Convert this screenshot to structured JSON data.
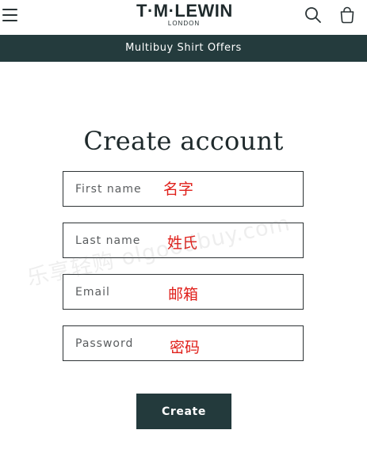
{
  "header": {
    "menu_icon": "hamburger-menu-icon",
    "logo_main": "T·M·LEWIN",
    "logo_sub": "LONDON",
    "search_icon": "search-icon",
    "cart_icon": "shopping-bag-icon"
  },
  "announcement": {
    "text": "Multibuy Shirt Offers"
  },
  "main": {
    "title": "Create account",
    "fields": [
      {
        "placeholder": "First name",
        "annotation": "名字"
      },
      {
        "placeholder": "Last name",
        "annotation": "姓氏"
      },
      {
        "placeholder": "Email",
        "annotation": "邮箱"
      },
      {
        "placeholder": "Password",
        "annotation": "密码"
      }
    ],
    "submit_label": "Create"
  },
  "watermark": "乐享轻购 olgoodbuy.com",
  "colors": {
    "brand_dark": "#243b3d",
    "annotation_red": "#e0201b",
    "text_dark": "#1f2a2c"
  }
}
